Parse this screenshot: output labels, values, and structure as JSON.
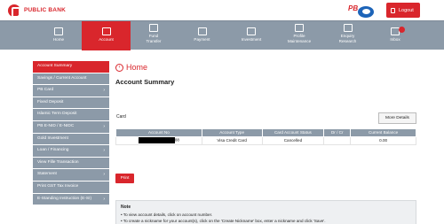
{
  "header": {
    "brand": "PUBLIC BANK",
    "partner_badge": "PB",
    "logout_label": "Logout"
  },
  "nav": [
    {
      "label": "Home",
      "icon": "home-icon",
      "active": false
    },
    {
      "label": "Account",
      "icon": "document-icon",
      "active": true
    },
    {
      "label": "Fund\nTransfer",
      "icon": "transfer-icon",
      "active": false
    },
    {
      "label": "Payment",
      "icon": "payment-icon",
      "active": false
    },
    {
      "label": "Investment",
      "icon": "investment-icon",
      "active": false
    },
    {
      "label": "Profile\nMaintenance",
      "icon": "profile-icon",
      "active": false
    },
    {
      "label": "Enquiry\nResearch",
      "icon": "enquiry-icon",
      "active": false
    },
    {
      "label": "Inbox",
      "icon": "mail-icon",
      "active": false
    }
  ],
  "sidebar": [
    {
      "label": "Account Summary",
      "active": true,
      "chevron": false
    },
    {
      "label": "Savings / Current Account",
      "active": false,
      "chevron": false
    },
    {
      "label": "PB Card",
      "active": false,
      "chevron": true
    },
    {
      "label": "Fixed Deposit",
      "active": false,
      "chevron": false
    },
    {
      "label": "Islamic Term Deposit",
      "active": false,
      "chevron": false
    },
    {
      "label": "PB E-NID / E-NIDC",
      "active": false,
      "chevron": true
    },
    {
      "label": "Gold Investment",
      "active": false,
      "chevron": false
    },
    {
      "label": "Loan / Financing",
      "active": false,
      "chevron": true
    },
    {
      "label": "View Fille Transaction",
      "active": false,
      "chevron": false
    },
    {
      "label": "Statement",
      "active": false,
      "chevron": true
    },
    {
      "label": "Print GST Tax Invoice",
      "active": false,
      "chevron": false
    },
    {
      "label": "E-Standing Instruction (E-SI)",
      "active": false,
      "chevron": true
    }
  ],
  "main": {
    "home_link": "Home",
    "page_title": "Account Summary",
    "section_label": "Card",
    "more_details_label": "More Details",
    "table": {
      "headers": [
        "Account No",
        "Account Type",
        "Card Account Status",
        "Dr / Cr",
        "Current Balance"
      ],
      "rows": [
        {
          "account_no_suffix": "88",
          "account_type": "Visa Credit Card",
          "status": "Cancelled",
          "drcr": "",
          "balance": "0.00"
        }
      ]
    },
    "print_label": "Print",
    "note": {
      "title": "Note",
      "lines": [
        "• To view account details, click on account number.",
        "• To create a nickname for your account(s), click on the 'Create Nickname' box, enter a nickname and click 'Save'."
      ]
    }
  },
  "colors": {
    "brand_red": "#d9262c",
    "nav_gray": "#8c9aa8"
  }
}
